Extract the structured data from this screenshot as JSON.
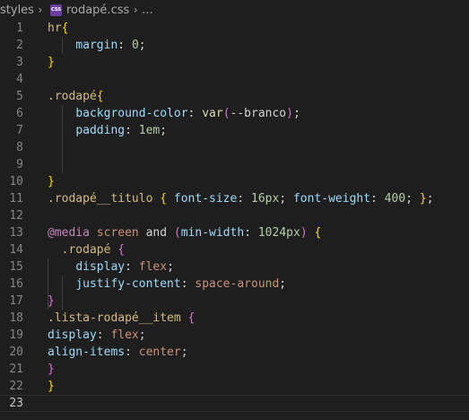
{
  "breadcrumb": {
    "folder": "styles",
    "file_icon": "CSS",
    "file_icon_name": "css-file-icon",
    "file_name": "rodapé.css",
    "ellipsis": "..."
  },
  "colors": {
    "background": "#1e1e1e",
    "line_number": "#858585",
    "selector": "#d7ba7d",
    "property": "#9cdcfe",
    "number": "#b5cea8",
    "value_string": "#ce9178",
    "function": "#dcdcaa",
    "at_rule": "#c586c0",
    "plain": "#d4d4d4",
    "bracket_level1": "#ffd700",
    "bracket_level2": "#da70d6",
    "bracket_level3": "#179fff",
    "css_icon": "#6a3fa0"
  },
  "editor": {
    "current_line": 23,
    "lines": [
      {
        "n": "1",
        "tokens": [
          [
            "sel",
            "hr"
          ],
          [
            "brace1",
            "{"
          ]
        ]
      },
      {
        "n": "2",
        "tokens": [
          [
            "plain",
            "    "
          ],
          [
            "prop",
            "margin"
          ],
          [
            "plain",
            ": "
          ],
          [
            "num",
            "0"
          ],
          [
            "plain",
            ";"
          ]
        ]
      },
      {
        "n": "3",
        "tokens": [
          [
            "brace1",
            "}"
          ]
        ]
      },
      {
        "n": "4",
        "tokens": []
      },
      {
        "n": "5",
        "tokens": [
          [
            "sel",
            ".rodapé"
          ],
          [
            "brace1",
            "{"
          ]
        ]
      },
      {
        "n": "6",
        "tokens": [
          [
            "plain",
            "    "
          ],
          [
            "prop",
            "background-color"
          ],
          [
            "plain",
            ": "
          ],
          [
            "fn",
            "var"
          ],
          [
            "brace2",
            "("
          ],
          [
            "plain",
            "--branco"
          ],
          [
            "brace2",
            ")"
          ],
          [
            "plain",
            ";"
          ]
        ]
      },
      {
        "n": "7",
        "tokens": [
          [
            "plain",
            "    "
          ],
          [
            "prop",
            "padding"
          ],
          [
            "plain",
            ": "
          ],
          [
            "num",
            "1em"
          ],
          [
            "plain",
            ";"
          ]
        ]
      },
      {
        "n": "8",
        "tokens": []
      },
      {
        "n": "9",
        "tokens": []
      },
      {
        "n": "10",
        "tokens": [
          [
            "brace1",
            "}"
          ]
        ]
      },
      {
        "n": "11",
        "tokens": [
          [
            "sel",
            ".rodapé__titulo"
          ],
          [
            "plain",
            " "
          ],
          [
            "brace1",
            "{"
          ],
          [
            "plain",
            " "
          ],
          [
            "prop",
            "font-size"
          ],
          [
            "plain",
            ": "
          ],
          [
            "num",
            "16px"
          ],
          [
            "plain",
            "; "
          ],
          [
            "prop",
            "font-weight"
          ],
          [
            "plain",
            ": "
          ],
          [
            "num",
            "400"
          ],
          [
            "plain",
            "; "
          ],
          [
            "brace1",
            "}"
          ],
          [
            "plain",
            ";"
          ]
        ]
      },
      {
        "n": "12",
        "tokens": []
      },
      {
        "n": "13",
        "tokens": [
          [
            "at",
            "@media"
          ],
          [
            "plain",
            " "
          ],
          [
            "str",
            "screen"
          ],
          [
            "plain",
            " and "
          ],
          [
            "brace2",
            "("
          ],
          [
            "prop",
            "min-width"
          ],
          [
            "plain",
            ": "
          ],
          [
            "num",
            "1024px"
          ],
          [
            "brace2",
            ")"
          ],
          [
            "plain",
            " "
          ],
          [
            "brace1",
            "{"
          ]
        ]
      },
      {
        "n": "14",
        "tokens": [
          [
            "plain",
            "  "
          ],
          [
            "sel",
            ".rodapé"
          ],
          [
            "plain",
            " "
          ],
          [
            "brace2",
            "{"
          ]
        ]
      },
      {
        "n": "15",
        "tokens": [
          [
            "plain",
            "    "
          ],
          [
            "prop",
            "display"
          ],
          [
            "plain",
            ": "
          ],
          [
            "str",
            "flex"
          ],
          [
            "plain",
            ";"
          ]
        ]
      },
      {
        "n": "16",
        "tokens": [
          [
            "plain",
            "    "
          ],
          [
            "prop",
            "justify-content"
          ],
          [
            "plain",
            ": "
          ],
          [
            "str",
            "space-around"
          ],
          [
            "plain",
            ";"
          ]
        ]
      },
      {
        "n": "17",
        "tokens": [
          [
            "brace2",
            "}"
          ]
        ]
      },
      {
        "n": "18",
        "tokens": [
          [
            "sel",
            ".lista-rodapé__item"
          ],
          [
            "plain",
            " "
          ],
          [
            "brace2",
            "{"
          ]
        ]
      },
      {
        "n": "19",
        "tokens": [
          [
            "prop",
            "display"
          ],
          [
            "plain",
            ": "
          ],
          [
            "str",
            "flex"
          ],
          [
            "plain",
            ";"
          ]
        ]
      },
      {
        "n": "20",
        "tokens": [
          [
            "prop",
            "align-items"
          ],
          [
            "plain",
            ": "
          ],
          [
            "str",
            "center"
          ],
          [
            "plain",
            ";"
          ]
        ]
      },
      {
        "n": "21",
        "tokens": [
          [
            "brace2",
            "}"
          ]
        ]
      },
      {
        "n": "22",
        "tokens": [
          [
            "brace1",
            "}"
          ]
        ]
      },
      {
        "n": "23",
        "tokens": []
      }
    ]
  }
}
